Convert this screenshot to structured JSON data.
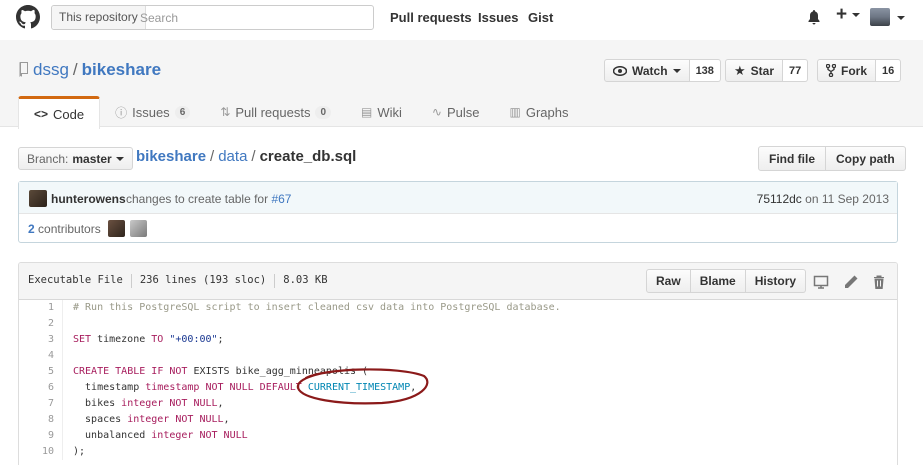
{
  "header": {
    "search_scope": "This repository",
    "search_placeholder": "Search",
    "nav": [
      "Pull requests",
      "Issues",
      "Gist"
    ],
    "plus_label": "+"
  },
  "repo": {
    "owner": "dssg",
    "name": "bikeshare",
    "watch": {
      "label": "Watch",
      "count": "138"
    },
    "star": {
      "label": "Star",
      "count": "77"
    },
    "fork": {
      "label": "Fork",
      "count": "16"
    }
  },
  "tabs": [
    {
      "label": "Code",
      "icon": "<>",
      "selected": true
    },
    {
      "label": "Issues",
      "icon": "ⓘ",
      "count": "6"
    },
    {
      "label": "Pull requests",
      "icon": "⇅",
      "count": "0"
    },
    {
      "label": "Wiki",
      "icon": "▤"
    },
    {
      "label": "Pulse",
      "icon": "∿"
    },
    {
      "label": "Graphs",
      "icon": "▥"
    }
  ],
  "file_nav": {
    "branch_prefix": "Branch:",
    "branch": "master",
    "path": {
      "repo": "bikeshare",
      "dir": "data",
      "file": "create_db.sql"
    },
    "find_file": "Find file",
    "copy_path": "Copy path"
  },
  "commit": {
    "author": "hunterowens",
    "message": "changes to create table for",
    "issue": "#67",
    "sha": "75112dc",
    "date_text": "on 11 Sep 2013",
    "contributors_count": "2",
    "contributors_label": "contributors"
  },
  "file": {
    "mode": "Executable File",
    "lines": "236 lines (193 sloc)",
    "size": "8.03 KB",
    "raw": "Raw",
    "blame": "Blame",
    "history": "History"
  },
  "code_lines": [
    {
      "num": "1",
      "tokens": [
        {
          "t": "# Run this PostgreSQL script to insert cleaned csv data into PostgreSQL database.",
          "c": "c-com"
        }
      ]
    },
    {
      "num": "2",
      "tokens": []
    },
    {
      "num": "3",
      "tokens": [
        {
          "t": "SET",
          "c": "c-kw"
        },
        {
          "t": " timezone ",
          "c": ""
        },
        {
          "t": "TO",
          "c": "c-kw"
        },
        {
          "t": " ",
          "c": ""
        },
        {
          "t": "\"+00:00\"",
          "c": "c-str"
        },
        {
          "t": ";",
          "c": ""
        }
      ]
    },
    {
      "num": "4",
      "tokens": []
    },
    {
      "num": "5",
      "tokens": [
        {
          "t": "CREATE",
          "c": "c-kw"
        },
        {
          "t": " ",
          "c": ""
        },
        {
          "t": "TABLE",
          "c": "c-kw"
        },
        {
          "t": " ",
          "c": ""
        },
        {
          "t": "IF",
          "c": "c-kw"
        },
        {
          "t": " ",
          "c": ""
        },
        {
          "t": "NOT",
          "c": "c-kw"
        },
        {
          "t": " EXISTS bike_agg_minneapolis (",
          "c": ""
        }
      ]
    },
    {
      "num": "6",
      "tokens": [
        {
          "t": "  timestamp ",
          "c": ""
        },
        {
          "t": "timestamp",
          "c": "c-kw"
        },
        {
          "t": " ",
          "c": ""
        },
        {
          "t": "NOT NULL",
          "c": "c-kw"
        },
        {
          "t": " ",
          "c": ""
        },
        {
          "t": "DEFAULT",
          "c": "c-kw"
        },
        {
          "t": " ",
          "c": ""
        },
        {
          "t": "CURRENT_TIMESTAMP",
          "c": "c-cst"
        },
        {
          "t": ",",
          "c": ""
        }
      ]
    },
    {
      "num": "7",
      "tokens": [
        {
          "t": "  bikes ",
          "c": ""
        },
        {
          "t": "integer",
          "c": "c-kw"
        },
        {
          "t": " ",
          "c": ""
        },
        {
          "t": "NOT NULL",
          "c": "c-kw"
        },
        {
          "t": ",",
          "c": ""
        }
      ]
    },
    {
      "num": "8",
      "tokens": [
        {
          "t": "  spaces ",
          "c": ""
        },
        {
          "t": "integer",
          "c": "c-kw"
        },
        {
          "t": " ",
          "c": ""
        },
        {
          "t": "NOT NULL",
          "c": "c-kw"
        },
        {
          "t": ",",
          "c": ""
        }
      ]
    },
    {
      "num": "9",
      "tokens": [
        {
          "t": "  unbalanced ",
          "c": ""
        },
        {
          "t": "integer",
          "c": "c-kw"
        },
        {
          "t": " ",
          "c": ""
        },
        {
          "t": "NOT NULL",
          "c": "c-kw"
        }
      ]
    },
    {
      "num": "10",
      "tokens": [
        {
          "t": ");",
          "c": ""
        }
      ]
    }
  ],
  "colors": {
    "accent_tab": "#d26911",
    "link": "#4078c0",
    "annotation": "#8b1a1a"
  }
}
